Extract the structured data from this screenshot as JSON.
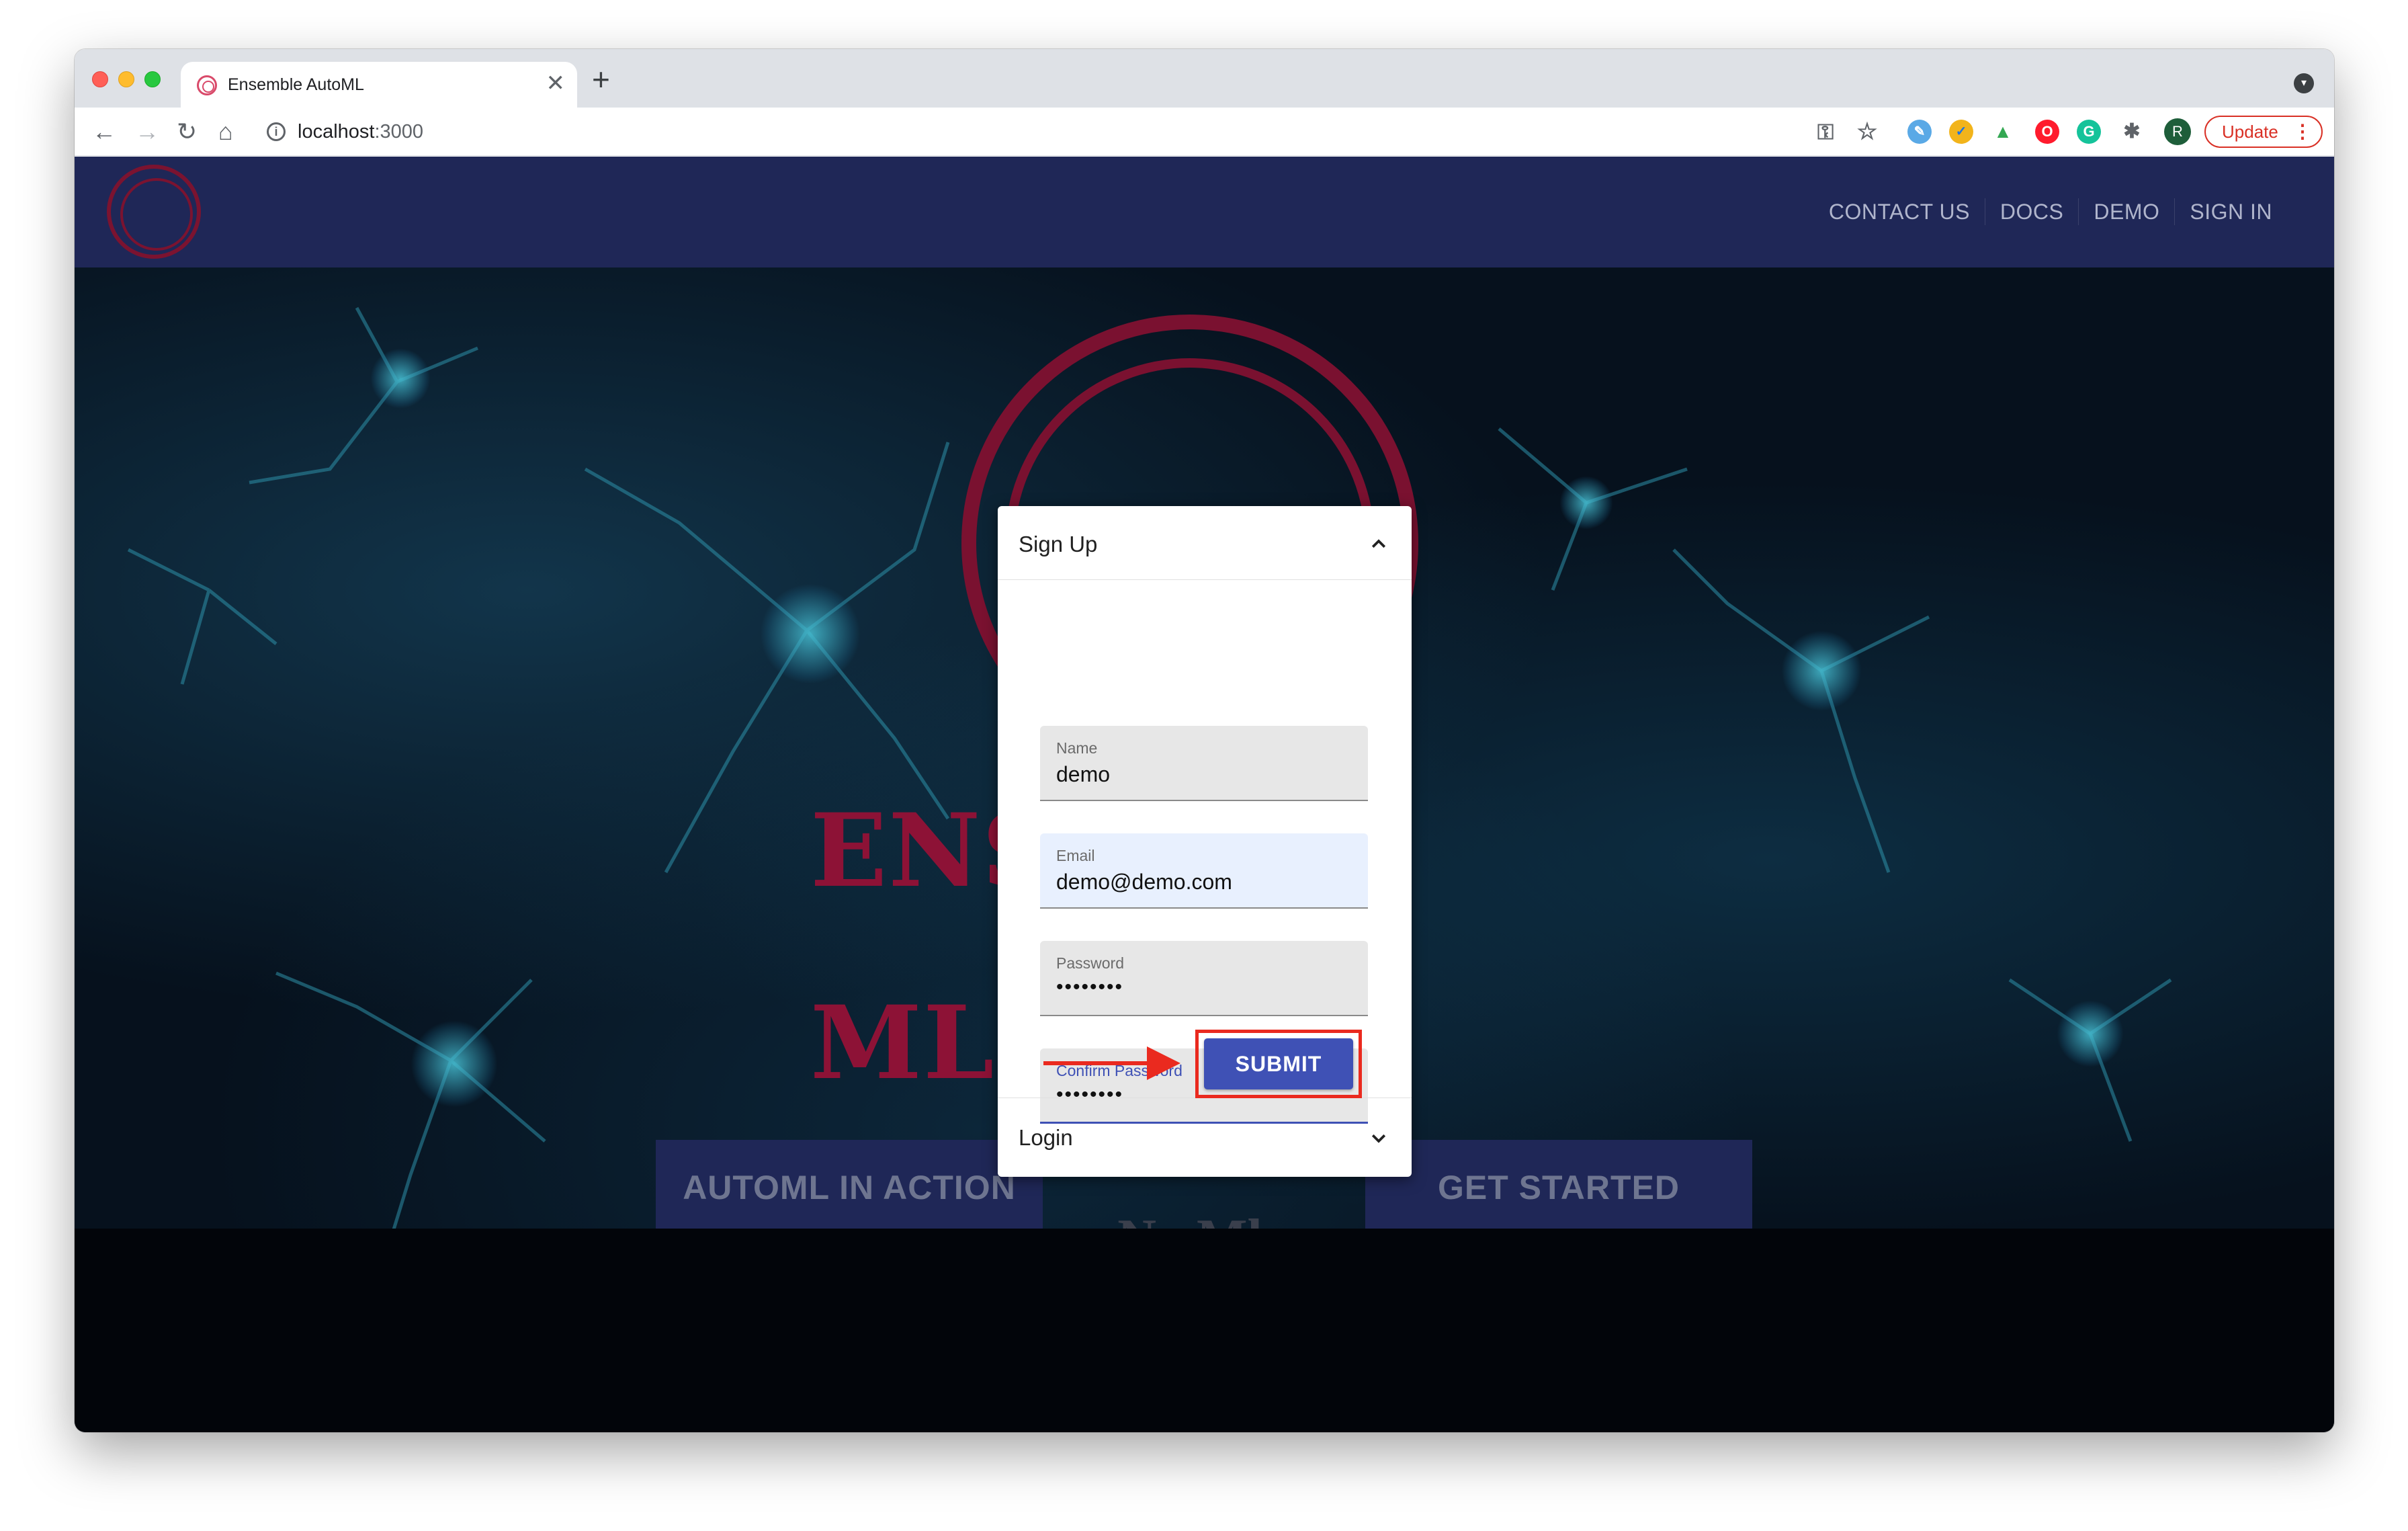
{
  "browser": {
    "tab_title": "Ensemble AutoML",
    "tab_close": "✕",
    "new_tab": "+",
    "url_host": "localhost",
    "url_port": ":3000",
    "profile_initial": "R",
    "update_label": "Update",
    "icons": [
      "back-icon",
      "forward-icon",
      "reload-icon",
      "home-icon",
      "info-icon",
      "key-icon",
      "star-icon",
      "extensions-icon"
    ]
  },
  "navbar": {
    "links": [
      "CONTACT US",
      "DOCS",
      "DEMO",
      "SIGN IN"
    ]
  },
  "hero": {
    "title_left": "ENS",
    "title_right": "ML",
    "subtitle": "No Ml",
    "cta_left": "AUTOML IN ACTION",
    "cta_right": "GET STARTED"
  },
  "signup": {
    "header": "Sign Up",
    "fields": {
      "name": {
        "label": "Name",
        "value": "demo"
      },
      "email": {
        "label": "Email",
        "value": "demo@demo.com"
      },
      "password": {
        "label": "Password",
        "value": "••••••••"
      },
      "confirm": {
        "label": "Confirm Password",
        "value": "••••••••"
      }
    },
    "submit_label": "SUBMIT"
  },
  "login": {
    "header": "Login"
  },
  "colors": {
    "navbar": "#1f2757",
    "accent": "#3f51b5",
    "brand_crimson": "#8d1236",
    "highlight": "#ea2a1f"
  }
}
